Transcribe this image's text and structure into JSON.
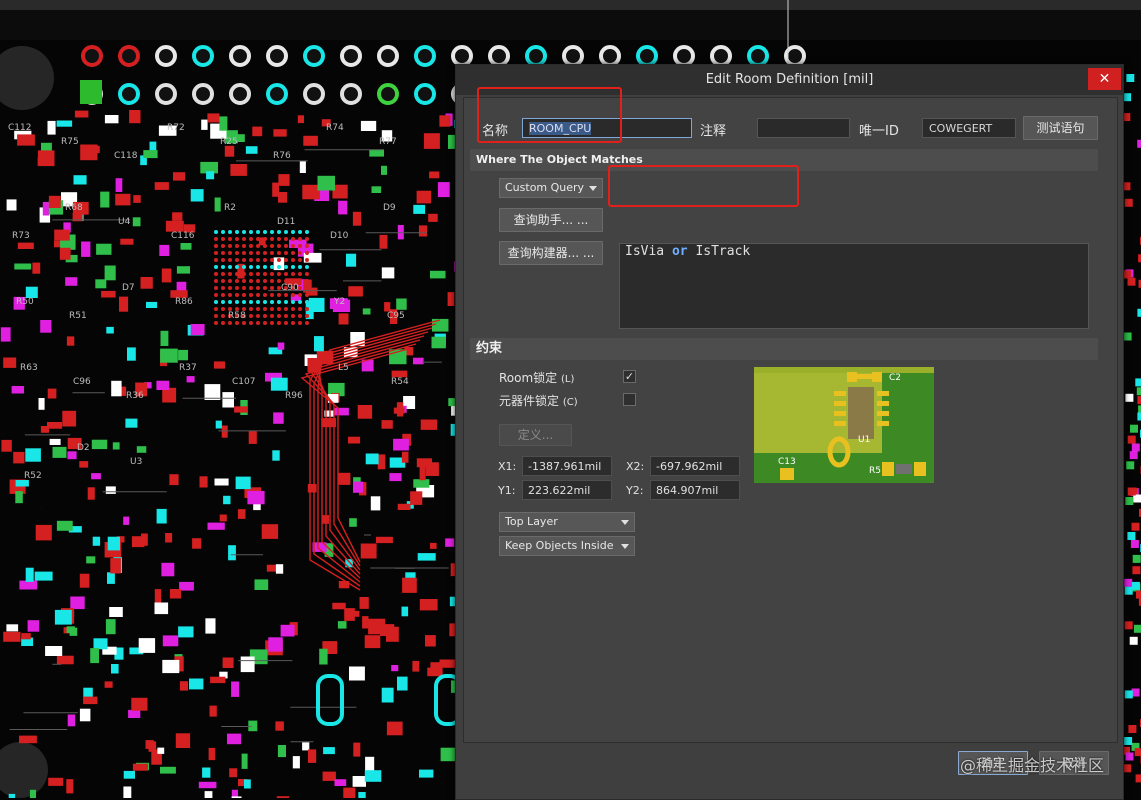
{
  "dialog": {
    "title": "Edit Room Definition [mil]",
    "close_symbol": "✕",
    "name_label": "名称",
    "name_value": "ROOM_CPU",
    "comment_label": "注释",
    "comment_value": "",
    "uid_label": "唯一ID",
    "uid_value": "COWEGERT",
    "test_button": "测试语句",
    "match_header": "Where The Object Matches",
    "query_mode": "Custom Query",
    "query_helper_button": "查询助手... ...",
    "query_builder_button": "查询构建器... ...",
    "query_text": {
      "a": "IsVia",
      "op": "or",
      "b": "IsTrack"
    },
    "constraints_header": "约束",
    "room_lock_label": "Room锁定",
    "room_lock_key": "(L)",
    "room_lock_checked": true,
    "comp_lock_label": "元器件锁定",
    "comp_lock_key": "(C)",
    "comp_lock_checked": false,
    "define_button": "定义...",
    "x1_label": "X1:",
    "x1_value": "-1387.961mil",
    "y1_label": "Y1:",
    "y1_value": "223.622mil",
    "x2_label": "X2:",
    "x2_value": "-697.962mil",
    "y2_label": "Y2:",
    "y2_value": "864.907mil",
    "layer_select": "Top Layer",
    "keep_select": "Keep Objects Inside",
    "preview_labels": {
      "c2": "C2",
      "u1": "U1",
      "c13": "C13",
      "r5": "R5"
    },
    "ok_button": "确定",
    "cancel_button": "取消"
  },
  "watermark": "@稀土掘金技术社区",
  "pcb_labels": [
    "C112",
    "R75",
    "C118",
    "R72",
    "R25",
    "R76",
    "R74",
    "R77",
    "R73",
    "R68",
    "U4",
    "C116",
    "R2",
    "D11",
    "D10",
    "D9",
    "R50",
    "R51",
    "D7",
    "R86",
    "R58",
    "C90",
    "Y2",
    "C95",
    "R63",
    "C96",
    "R36",
    "R37",
    "C107",
    "R96",
    "L5",
    "R54",
    "R52",
    "D2",
    "U3"
  ],
  "colors": {
    "accent_red": "#e0201b",
    "pad_cyan": "#19e6e6",
    "trace_red": "#d42020",
    "board_bg": "#050505"
  }
}
